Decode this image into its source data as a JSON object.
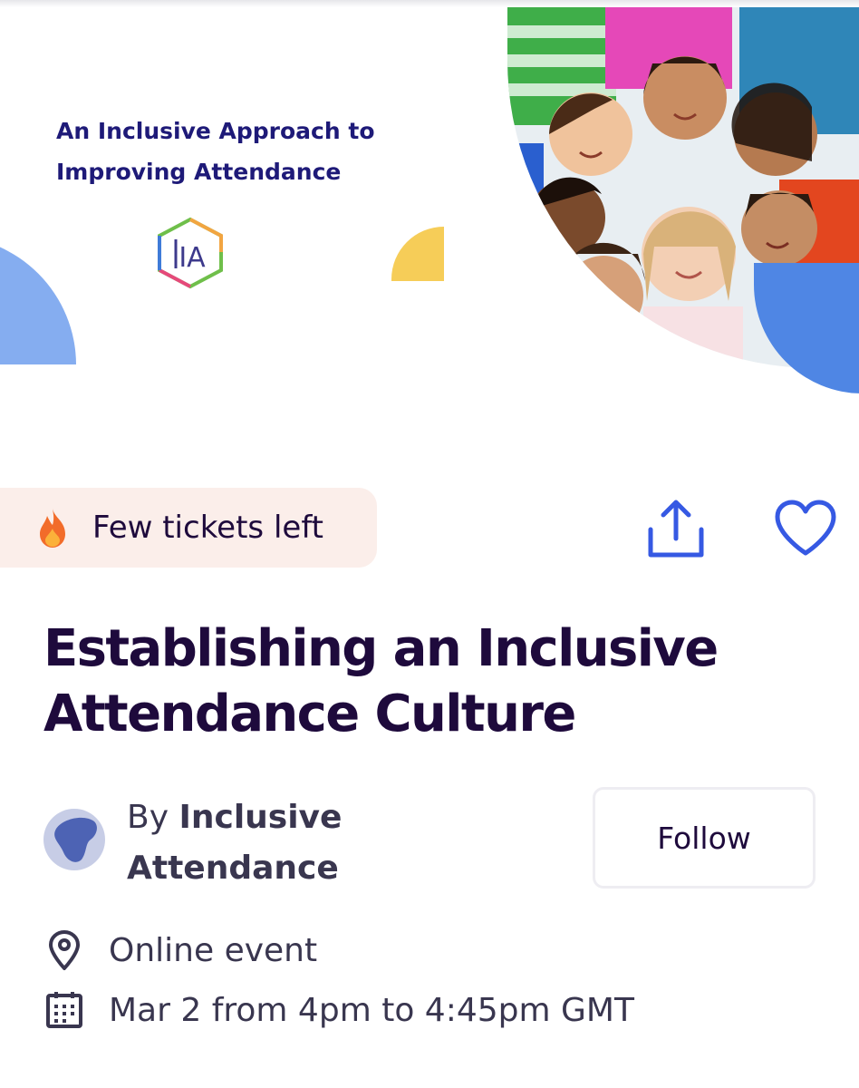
{
  "banner": {
    "title_line1": "An Inclusive Approach to",
    "title_line2": "Improving Attendance",
    "logo_letters": "IA"
  },
  "badge": {
    "icon": "fire-icon",
    "label": "Few tickets left",
    "background": "#fbeeea"
  },
  "actions": {
    "share_icon": "share-icon",
    "like_icon": "heart-icon",
    "color": "#3659e3"
  },
  "event": {
    "title": "Establishing an Inclusive Attendance Culture"
  },
  "organizer": {
    "prefix": "By ",
    "name": "Inclusive Attendance",
    "follow_label": "Follow"
  },
  "details": {
    "location_icon": "location-pin-icon",
    "location": "Online event",
    "date_icon": "calendar-icon",
    "date": "Mar 2 from 4pm to 4:45pm GMT"
  },
  "colors": {
    "title": "#1e0a3c",
    "body_text": "#39364f",
    "banner_title": "#1e1a78",
    "deco_blue": "#4f86e4",
    "deco_light_blue": "#85adf0",
    "deco_yellow": "#f6cd58"
  }
}
